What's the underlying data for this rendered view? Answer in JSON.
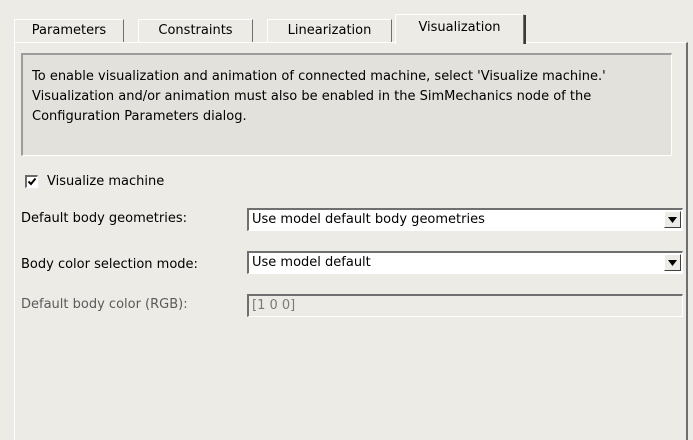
{
  "tabs": [
    {
      "label": "Parameters",
      "active": false
    },
    {
      "label": "Constraints",
      "active": false
    },
    {
      "label": "Linearization",
      "active": false
    },
    {
      "label": "Visualization",
      "active": true
    }
  ],
  "info": {
    "text": "To enable visualization and animation of connected machine, select 'Visualize machine.' Visualization and/or animation must also be enabled in the SimMechanics node of the Configuration Parameters dialog."
  },
  "visualize": {
    "label": "Visualize machine",
    "checked": true
  },
  "fields": {
    "geometry": {
      "label": "Default body geometries:",
      "value": "Use model default body geometries"
    },
    "color_mode": {
      "label": "Body color selection mode:",
      "value": "Use model default"
    },
    "color_rgb": {
      "label": "Default body color (RGB):",
      "value": "[1 0 0]",
      "disabled": true
    }
  },
  "icons": {
    "checkmark": "checkmark-icon",
    "dropdown": "dropdown-arrow-icon"
  }
}
